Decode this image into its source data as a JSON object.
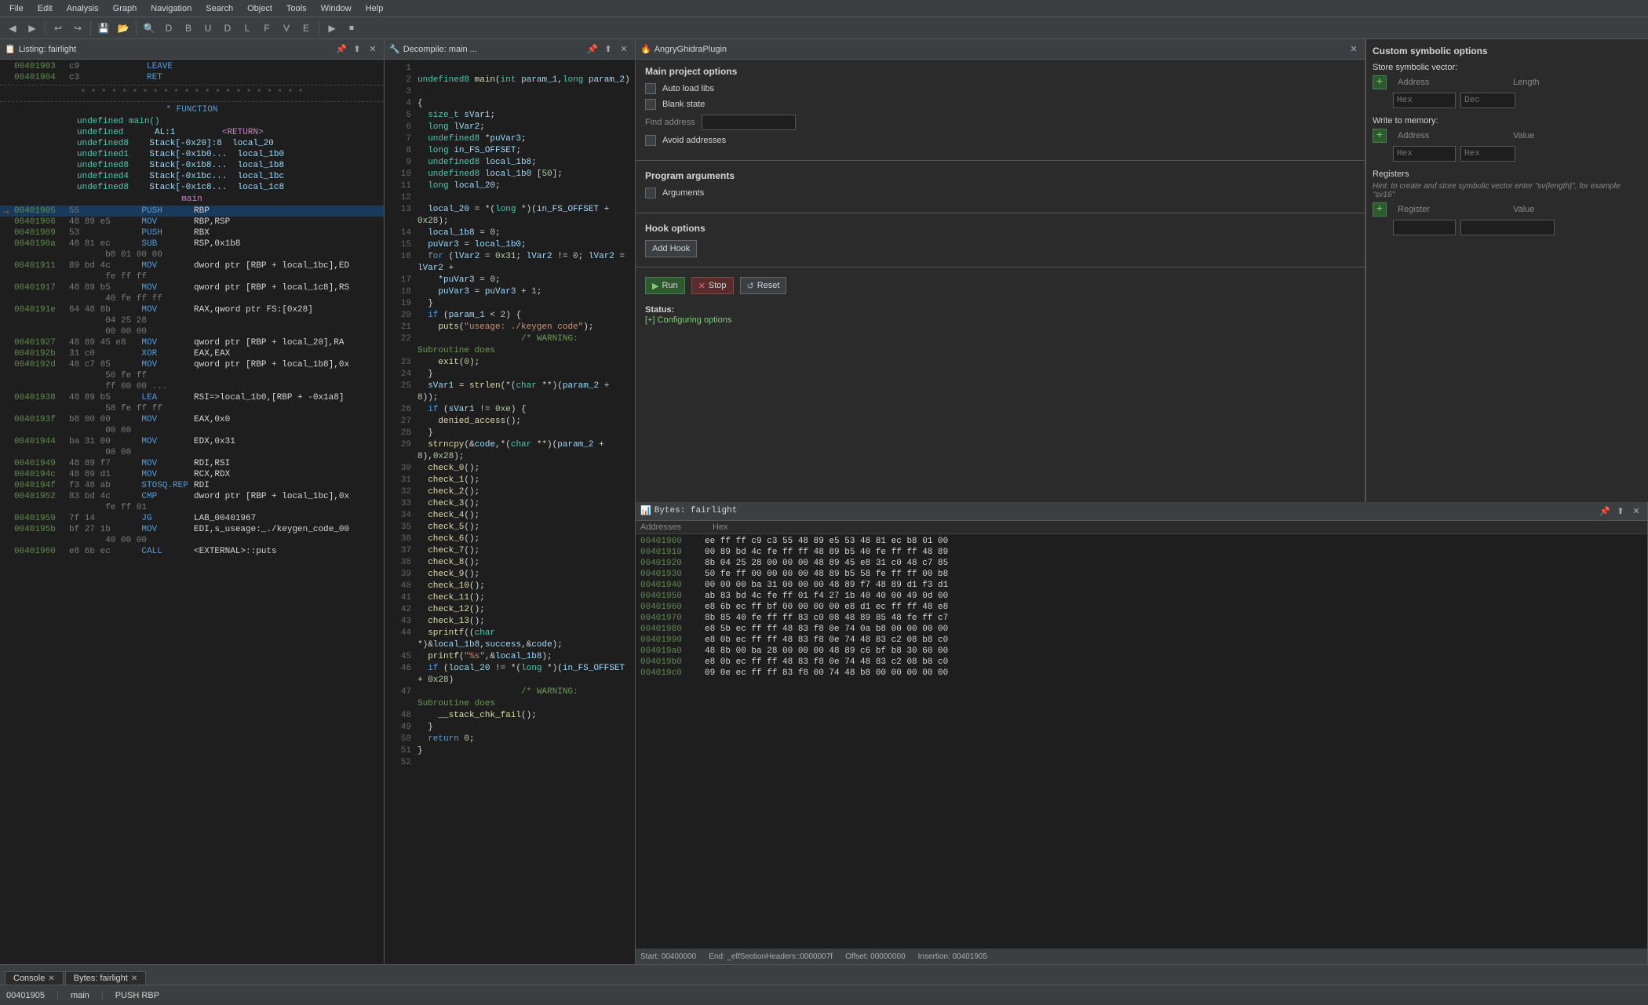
{
  "menubar": {
    "items": [
      "File",
      "Edit",
      "Analysis",
      "Graph",
      "Navigation",
      "Search",
      "Object",
      "Tools",
      "Window",
      "Help"
    ]
  },
  "listing_panel": {
    "title": "Listing:  fairlight",
    "rows": [
      {
        "addr": "00401903",
        "bytes": "c9",
        "mnemonic": "LEAVE",
        "operand": "",
        "indent": 16
      },
      {
        "addr": "00401904",
        "bytes": "c3",
        "mnemonic": "RET",
        "operand": "",
        "indent": 16
      },
      {
        "type": "separator"
      },
      {
        "type": "func_header",
        "text": "FUNCTION"
      },
      {
        "type": "func_def",
        "text": "undefined main()"
      },
      {
        "type": "var",
        "type_name": "undefined",
        "reg": "AL:1",
        "name": "<RETURN>"
      },
      {
        "type": "var",
        "type_name": "undefined8",
        "loc": "Stack[-0x20]:8",
        "name": "local_20"
      },
      {
        "type": "var",
        "type_name": "undefined1",
        "loc": "Stack[-0x1b0...",
        "name": "local_1b0"
      },
      {
        "type": "var",
        "type_name": "undefined8",
        "loc": "Stack[-0x1b8...",
        "name": "local_1b8"
      },
      {
        "type": "var",
        "type_name": "undefined4",
        "loc": "Stack[-0x1bc...",
        "name": "local_1bc"
      },
      {
        "type": "var",
        "type_name": "undefined8",
        "loc": "Stack[-0x1c8...",
        "name": "local_1c8"
      },
      {
        "type": "func_name",
        "text": "main"
      },
      {
        "addr": "00401905",
        "bytes": "55",
        "mnemonic": "PUSH",
        "operand": "RBP",
        "current": true
      },
      {
        "addr": "00401906",
        "bytes": "48 89 e5",
        "mnemonic": "MOV",
        "operand": "RBP,RSP"
      },
      {
        "addr": "00401909",
        "bytes": "53",
        "mnemonic": "PUSH",
        "operand": "RBX"
      },
      {
        "addr": "0040190a",
        "bytes": "48 81 ec",
        "mnemonic": "SUB",
        "operand": "RSP,0x1b8"
      },
      {
        "addr": "",
        "bytes": "b8 01 00 00",
        "mnemonic": "",
        "operand": ""
      },
      {
        "addr": "00401911",
        "bytes": "89 bd 4c",
        "mnemonic": "MOV",
        "operand": "dword ptr [RBP + local_1bc],ED"
      },
      {
        "addr": "",
        "bytes": "fe ff ff",
        "mnemonic": "",
        "operand": ""
      },
      {
        "addr": "00401917",
        "bytes": "48 89 b5",
        "mnemonic": "MOV",
        "operand": "qword ptr [RBP + local_1c8],RS"
      },
      {
        "addr": "",
        "bytes": "40 fe ff ff",
        "mnemonic": "",
        "operand": ""
      },
      {
        "addr": "0040191e",
        "bytes": "64 48 8b",
        "mnemonic": "MOV",
        "operand": "RAX,qword ptr FS:[0x28]"
      },
      {
        "addr": "",
        "bytes": "04 25 28",
        "mnemonic": "",
        "operand": ""
      },
      {
        "addr": "",
        "bytes": "00 00 00",
        "mnemonic": "",
        "operand": ""
      },
      {
        "addr": "00401927",
        "bytes": "48 89 45 e8",
        "mnemonic": "MOV",
        "operand": "qword ptr [RBP + local_20],RA"
      },
      {
        "addr": "0040192b",
        "bytes": "31 c0",
        "mnemonic": "XOR",
        "operand": "EAX,EAX"
      },
      {
        "addr": "0040192d",
        "bytes": "48 c7 85",
        "mnemonic": "MOV",
        "operand": "qword ptr [RBP + local_1b8],0x"
      },
      {
        "addr": "",
        "bytes": "50 fe ff",
        "mnemonic": "",
        "operand": ""
      },
      {
        "addr": "",
        "bytes": "ff 00 00 ...",
        "mnemonic": "",
        "operand": ""
      },
      {
        "addr": "00401938",
        "bytes": "48 89 b5",
        "mnemonic": "LEA",
        "operand": "RSI=>local_1b0,[RBP + -0x1a8]"
      },
      {
        "addr": "",
        "bytes": "58 fe ff ff",
        "mnemonic": "",
        "operand": ""
      },
      {
        "addr": "0040193f",
        "bytes": "b8 00 00",
        "mnemonic": "MOV",
        "operand": "EAX,0x0"
      },
      {
        "addr": "",
        "bytes": "00 00",
        "mnemonic": "",
        "operand": ""
      },
      {
        "addr": "00401944",
        "bytes": "ba 31 00",
        "mnemonic": "MOV",
        "operand": "EDX,0x31"
      },
      {
        "addr": "",
        "bytes": "00 00",
        "mnemonic": "",
        "operand": ""
      },
      {
        "addr": "00401949",
        "bytes": "48 89 f7",
        "mnemonic": "MOV",
        "operand": "RDI,RSI"
      },
      {
        "addr": "0040194c",
        "bytes": "48 89 d1",
        "mnemonic": "MOV",
        "operand": "RCX,RDX"
      },
      {
        "addr": "0040194f",
        "bytes": "f3 48 ab",
        "mnemonic": "STOSQ.REP",
        "operand": "RDI"
      },
      {
        "addr": "00401952",
        "bytes": "83 bd 4c",
        "mnemonic": "CMP",
        "operand": "dword ptr [RBP + local_1bc],0x"
      },
      {
        "addr": "",
        "bytes": "fe ff 01",
        "mnemonic": "",
        "operand": ""
      },
      {
        "addr": "00401959",
        "bytes": "7f 14",
        "mnemonic": "JG",
        "operand": "LAB_00401967"
      },
      {
        "addr": "0040195b",
        "bytes": "bf 27 1b",
        "mnemonic": "MOV",
        "operand": "EDI,s_useage:_./keygen_code_00"
      },
      {
        "addr": "",
        "bytes": "40 00 00",
        "mnemonic": "",
        "operand": ""
      },
      {
        "addr": "00401960",
        "bytes": "e8 6b ec",
        "mnemonic": "CALL",
        "operand": "<EXTERNAL>::puts"
      }
    ]
  },
  "decompile_panel": {
    "title": "Decompile: main ...",
    "lines": [
      {
        "num": "1",
        "text": ""
      },
      {
        "num": "2",
        "text": "undefined8 main(int param_1,long param_2)"
      },
      {
        "num": "3",
        "text": ""
      },
      {
        "num": "4",
        "text": "{"
      },
      {
        "num": "5",
        "text": "  size_t sVar1;"
      },
      {
        "num": "6",
        "text": "  long lVar2;"
      },
      {
        "num": "7",
        "text": "  undefined8 *puVar3;"
      },
      {
        "num": "8",
        "text": "  long in_FS_OFFSET;"
      },
      {
        "num": "9",
        "text": "  undefined8 local_1b8;"
      },
      {
        "num": "10",
        "text": "  undefined8 local_1b0 [50];"
      },
      {
        "num": "11",
        "text": "  long local_20;"
      },
      {
        "num": "12",
        "text": ""
      },
      {
        "num": "13",
        "text": "  local_20 = *(long *)(in_FS_OFFSET + 0x28);"
      },
      {
        "num": "14",
        "text": "  local_1b8 = 0;"
      },
      {
        "num": "15",
        "text": "  puVar3 = local_1b0;"
      },
      {
        "num": "16",
        "text": "  for (lVar2 = 0x31; lVar2 != 0; lVar2 = lVar2 +"
      },
      {
        "num": "17",
        "text": "    *puVar3 = 0;"
      },
      {
        "num": "18",
        "text": "    puVar3 = puVar3 + 1;"
      },
      {
        "num": "19",
        "text": "  }"
      },
      {
        "num": "20",
        "text": "  if (param_1 < 2) {"
      },
      {
        "num": "21",
        "text": "    puts(\"useage: ./keygen code\");"
      },
      {
        "num": "22",
        "text": "                    /* WARNING: Subroutine does"
      },
      {
        "num": "23",
        "text": "    exit(0);"
      },
      {
        "num": "24",
        "text": "  }"
      },
      {
        "num": "25",
        "text": "  sVar1 = strlen(*(char **)(param_2 + 8));"
      },
      {
        "num": "26",
        "text": "  if (sVar1 != 0xe) {"
      },
      {
        "num": "27",
        "text": "    denied_access();"
      },
      {
        "num": "28",
        "text": "  }"
      },
      {
        "num": "29",
        "text": "  strncpy(&code,*(char **)(param_2 + 8),0x28);"
      },
      {
        "num": "30",
        "text": "  check_0();"
      },
      {
        "num": "31",
        "text": "  check_1();"
      },
      {
        "num": "32",
        "text": "  check_2();"
      },
      {
        "num": "33",
        "text": "  check_3();"
      },
      {
        "num": "34",
        "text": "  check_4();"
      },
      {
        "num": "35",
        "text": "  check_5();"
      },
      {
        "num": "36",
        "text": "  check_6();"
      },
      {
        "num": "37",
        "text": "  check_7();"
      },
      {
        "num": "38",
        "text": "  check_8();"
      },
      {
        "num": "39",
        "text": "  check_9();"
      },
      {
        "num": "40",
        "text": "  check_10();"
      },
      {
        "num": "41",
        "text": "  check_11();"
      },
      {
        "num": "42",
        "text": "  check_12();"
      },
      {
        "num": "43",
        "text": "  check_13();"
      },
      {
        "num": "44",
        "text": "  sprintf((char *)&local_1b8,success,&code);"
      },
      {
        "num": "45",
        "text": "  printf(\"%s\",&local_1b8);"
      },
      {
        "num": "46",
        "text": "  if (local_20 != *(long *)(in_FS_OFFSET + 0x28)"
      },
      {
        "num": "47",
        "text": "                    /* WARNING: Subroutine does"
      },
      {
        "num": "48",
        "text": "    __stack_chk_fail();"
      },
      {
        "num": "49",
        "text": "  }"
      },
      {
        "num": "50",
        "text": "  return 0;"
      },
      {
        "num": "51",
        "text": "}"
      },
      {
        "num": "52",
        "text": ""
      }
    ]
  },
  "angry_panel": {
    "title": "AngryGhidraPlugin",
    "main_project_title": "Main project options",
    "auto_load_libs_label": "Auto load libs",
    "blank_state_label": "Blank state",
    "find_address_label": "Find address",
    "avoid_addresses_label": "Avoid addresses",
    "program_args_title": "Program arguments",
    "arguments_label": "Arguments",
    "hook_options_title": "Hook options",
    "add_hook_label": "Add Hook",
    "run_label": "Run",
    "stop_label": "Stop",
    "reset_label": "Reset",
    "status_label": "Status:",
    "status_value": "[+] Configuring options",
    "custom_symbolic_title": "Custom symbolic options",
    "store_symbolic_label": "Store symbolic vector:",
    "address_label": "Address",
    "length_label": "Length",
    "hex_label": "Hex",
    "dec_label": "Dec",
    "write_memory_label": "Write to memory:",
    "value_label": "Value",
    "registers_title": "Registers",
    "registers_hint": "Hint: to create and store symbolic vector enter \"sv{length}\", for example \"sv16\"",
    "register_label": "Register",
    "register_value_label": "Value"
  },
  "bytes_panel": {
    "title": "Bytes: fairlight",
    "col_headers": [
      "Addresses",
      "Hex"
    ],
    "rows": [
      {
        "addr": "00401900",
        "hex": "ee ff ff c9 c3 55 48 89 e5 53 48 81 ec b8 01 00"
      },
      {
        "addr": "00401910",
        "hex": "00 89 bd 4c fe ff ff 48 89 b5 40 fe ff ff 48 89"
      },
      {
        "addr": "00401920",
        "hex": "8b 04 25 28 00 00 00 48 89 45 e8 31 c0 48 c7 85"
      },
      {
        "addr": "00401930",
        "hex": "50 fe ff 00 00 00 00 48 89 b5 58 fe ff ff 00 b8"
      },
      {
        "addr": "00401940",
        "hex": "00 00 00 ba 31 00 00 00 48 89 f7 48 89 d1 f3 d1"
      },
      {
        "addr": "00401950",
        "hex": "ab 83 bd 4c fe ff 01 f4 27 1b 40 40 00 49 0d 00"
      },
      {
        "addr": "00401960",
        "hex": "e8 6b ec ff bf 00 00 00 00 e8 d1 ec ff ff 48 e8"
      },
      {
        "addr": "00401970",
        "hex": "8b 85 40 fe ff ff 83 c0 08 48 89 85 48 fe ff c7"
      },
      {
        "addr": "00401980",
        "hex": "e8 5b ec ff ff 48 83 f8 0e 74 0a b8 00 00 00 00"
      },
      {
        "addr": "00401990",
        "hex": "e8 0b ec ff ff 48 83 f8 0e 74 48 83 c2 08 b8 c0"
      },
      {
        "addr": "004019a0",
        "hex": "48 8b 00 ba 28 00 00 00 48 89 c6 bf b8 30 60 00"
      },
      {
        "addr": "004019b0",
        "hex": "e8 0b ec ff ff 48 83 f8 0e 74 48 83 c2 08 b8 c0"
      },
      {
        "addr": "004019c0",
        "hex": "09 0e ec ff ff 83 f8 00 74 48 b8 00 00 00 00 00"
      }
    ],
    "footer": {
      "start_label": "Start:",
      "start_val": "00400000",
      "end_label": "End: _elfSectionHeaders::0000007f",
      "offset_label": "Offset:",
      "offset_val": "00000000",
      "insertion_label": "Insertion:",
      "insertion_val": "00401905"
    }
  },
  "status_bar": {
    "addr": "00401905",
    "func": "main",
    "instr": "PUSH RBP"
  },
  "bottom_tabs": [
    {
      "label": "Console",
      "active": false,
      "closeable": true
    },
    {
      "label": "Bytes: fairlight",
      "active": false,
      "closeable": true
    }
  ]
}
